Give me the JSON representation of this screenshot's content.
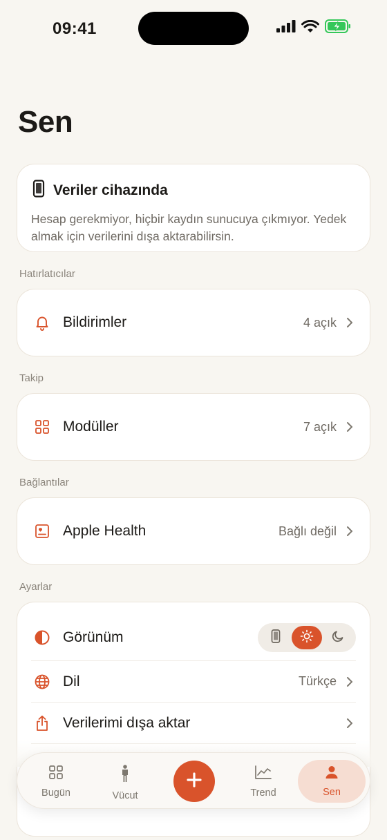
{
  "status_bar": {
    "time": "09:41"
  },
  "page_title": "Sen",
  "info_card": {
    "icon": "phone-icon",
    "title": "Veriler cihazında",
    "text": "Hesap gerekmiyor, hiçbir kaydın sunucuya çıkmıyor. Yedek almak için verilerini dışa aktarabilirsin."
  },
  "sections": {
    "reminders": {
      "label": "Hatırlatıcılar",
      "row": {
        "icon": "bell-icon",
        "label": "Bildirimler",
        "value": "4 açık"
      }
    },
    "tracking": {
      "label": "Takip",
      "row": {
        "icon": "grid-icon",
        "label": "Modüller",
        "value": "7 açık"
      }
    },
    "connections": {
      "label": "Bağlantılar",
      "row": {
        "icon": "health-icon",
        "label": "Apple Health",
        "value": "Bağlı değil"
      }
    },
    "settings": {
      "label": "Ayarlar",
      "appearance": {
        "icon": "contrast-icon",
        "label": "Görünüm",
        "options": [
          "device-icon",
          "sun-icon",
          "moon-icon"
        ],
        "selected": "sun-icon"
      },
      "language": {
        "icon": "globe-icon",
        "label": "Dil",
        "value": "Türkçe"
      },
      "export": {
        "icon": "share-icon",
        "label": "Verilerimi dışa aktar"
      }
    }
  },
  "tab_bar": {
    "today": "Bugün",
    "body": "Vücut",
    "add": "+",
    "trend": "Trend",
    "me": "Sen",
    "active": "me"
  },
  "colors": {
    "accent": "#d9532b",
    "background": "#f8f6f1",
    "card": "#ffffff",
    "active_tab_bg": "#f6ddd2"
  }
}
